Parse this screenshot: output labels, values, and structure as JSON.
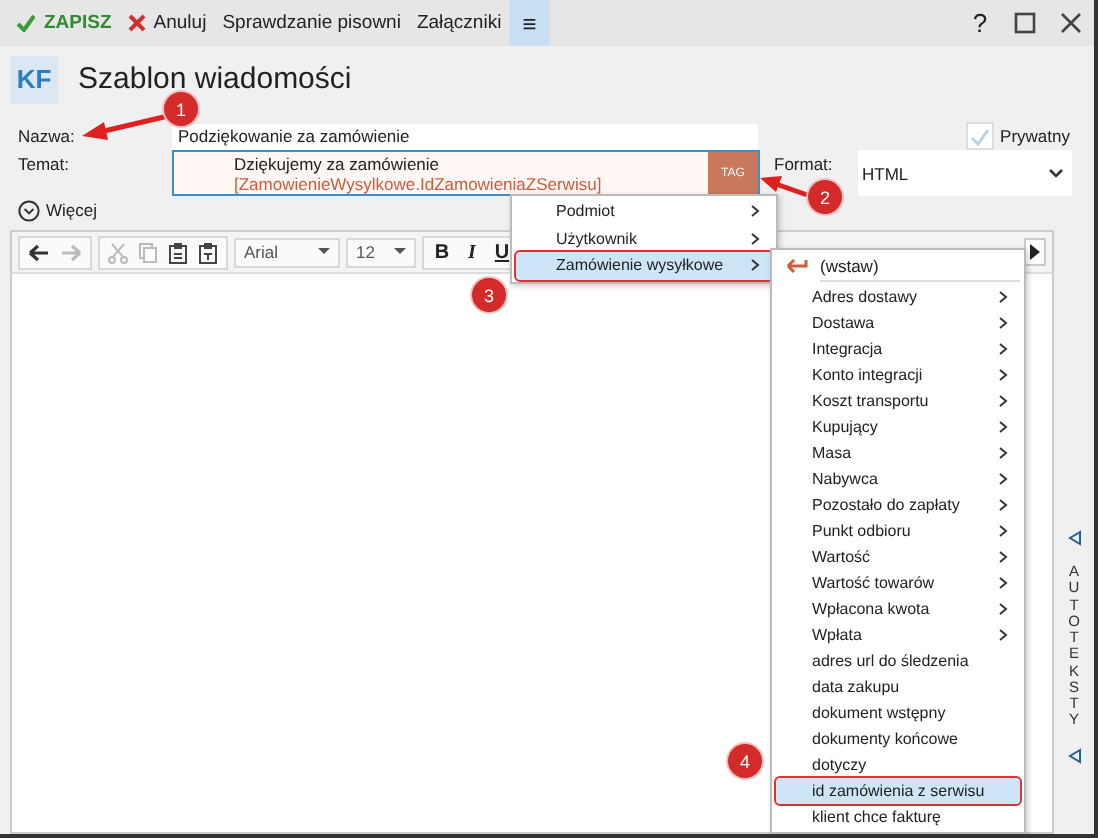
{
  "toolbar": {
    "save": "ZAPISZ",
    "cancel": "Anuluj",
    "spellcheck": "Sprawdzanie pisowni",
    "attachments": "Załączniki",
    "menu_glyph": "≡",
    "help": "?"
  },
  "header": {
    "badge": "KF",
    "title": "Szablon wiadomości"
  },
  "form": {
    "name_label": "Nazwa:",
    "name_value": "Podziękowanie za zamówienie",
    "subject_label": "Temat:",
    "subject_text": "Dziękujemy za zamówienie",
    "subject_tag": "[ZamowienieWysylkowe.IdZamowieniaZSerwisu]",
    "tag_button": "TAG",
    "private": {
      "label": "Prywatny",
      "checked": true
    },
    "format_label": "Format:",
    "format_value": "HTML"
  },
  "more": "Więcej",
  "editor_toolbar": {
    "font": "Arial",
    "size": "12",
    "bold": "B",
    "italic": "I",
    "underline": "U"
  },
  "context_menu": [
    {
      "label": "Podmiot",
      "selected": false
    },
    {
      "label": "Użytkownik",
      "selected": false
    },
    {
      "label": "Zamówienie wysyłkowe",
      "selected": true
    }
  ],
  "submenu": {
    "insert": "(wstaw)",
    "items": [
      {
        "label": "Adres dostawy",
        "has_submenu": true,
        "selected": false
      },
      {
        "label": "Dostawa",
        "has_submenu": true,
        "selected": false
      },
      {
        "label": "Integracja",
        "has_submenu": true,
        "selected": false
      },
      {
        "label": "Konto integracji",
        "has_submenu": true,
        "selected": false
      },
      {
        "label": "Koszt transportu",
        "has_submenu": true,
        "selected": false
      },
      {
        "label": "Kupujący",
        "has_submenu": true,
        "selected": false
      },
      {
        "label": "Masa",
        "has_submenu": true,
        "selected": false
      },
      {
        "label": "Nabywca",
        "has_submenu": true,
        "selected": false
      },
      {
        "label": "Pozostało do zapłaty",
        "has_submenu": true,
        "selected": false
      },
      {
        "label": "Punkt odbioru",
        "has_submenu": true,
        "selected": false
      },
      {
        "label": "Wartość",
        "has_submenu": true,
        "selected": false
      },
      {
        "label": "Wartość towarów",
        "has_submenu": true,
        "selected": false
      },
      {
        "label": "Wpłacona kwota",
        "has_submenu": true,
        "selected": false
      },
      {
        "label": "Wpłata",
        "has_submenu": true,
        "selected": false
      },
      {
        "label": "adres url do śledzenia",
        "has_submenu": false,
        "selected": false
      },
      {
        "label": "data zakupu",
        "has_submenu": false,
        "selected": false
      },
      {
        "label": "dokument wstępny",
        "has_submenu": false,
        "selected": false
      },
      {
        "label": "dokumenty końcowe",
        "has_submenu": false,
        "selected": false
      },
      {
        "label": "dotyczy",
        "has_submenu": false,
        "selected": false
      },
      {
        "label": "id zamówienia z serwisu",
        "has_submenu": false,
        "selected": true
      },
      {
        "label": "klient chce fakturę",
        "has_submenu": false,
        "selected": false
      }
    ]
  },
  "side_panel": {
    "label": "AUTOTEKSTY"
  },
  "annotations": [
    {
      "number": "1"
    },
    {
      "number": "2"
    },
    {
      "number": "3"
    },
    {
      "number": "4"
    }
  ]
}
